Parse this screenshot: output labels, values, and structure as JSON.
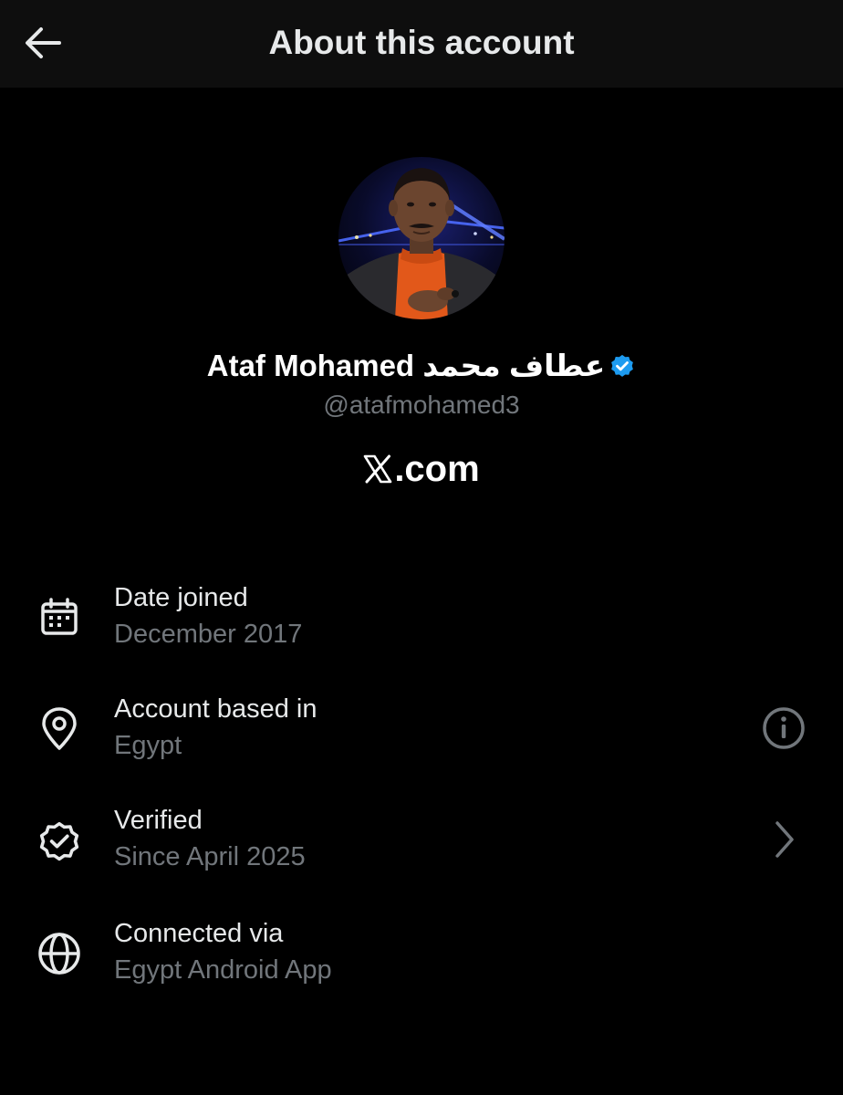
{
  "header": {
    "title": "About this account",
    "back_icon": "arrow-left-icon"
  },
  "profile": {
    "display_name": "Ataf Mohamed عطاف محمد",
    "handle": "@atafmohamed3",
    "verified": true,
    "badge_color": "#1d9bf0",
    "site": ".com",
    "site_logo": "x-logo-icon"
  },
  "details": [
    {
      "icon": "calendar-icon",
      "title": "Date joined",
      "value": "December 2017"
    },
    {
      "icon": "location-pin-icon",
      "title": "Account based in",
      "value": "Egypt",
      "action_icon": "info-icon"
    },
    {
      "icon": "verified-badge-icon",
      "title": "Verified",
      "value": "Since April 2025",
      "action_icon": "chevron-right-icon"
    },
    {
      "icon": "globe-icon",
      "title": "Connected via",
      "value": "Egypt Android App"
    }
  ],
  "colors": {
    "background": "#000000",
    "header_background": "#0e0e0e",
    "primary_text": "#e7e9ea",
    "secondary_text": "#71767b"
  }
}
